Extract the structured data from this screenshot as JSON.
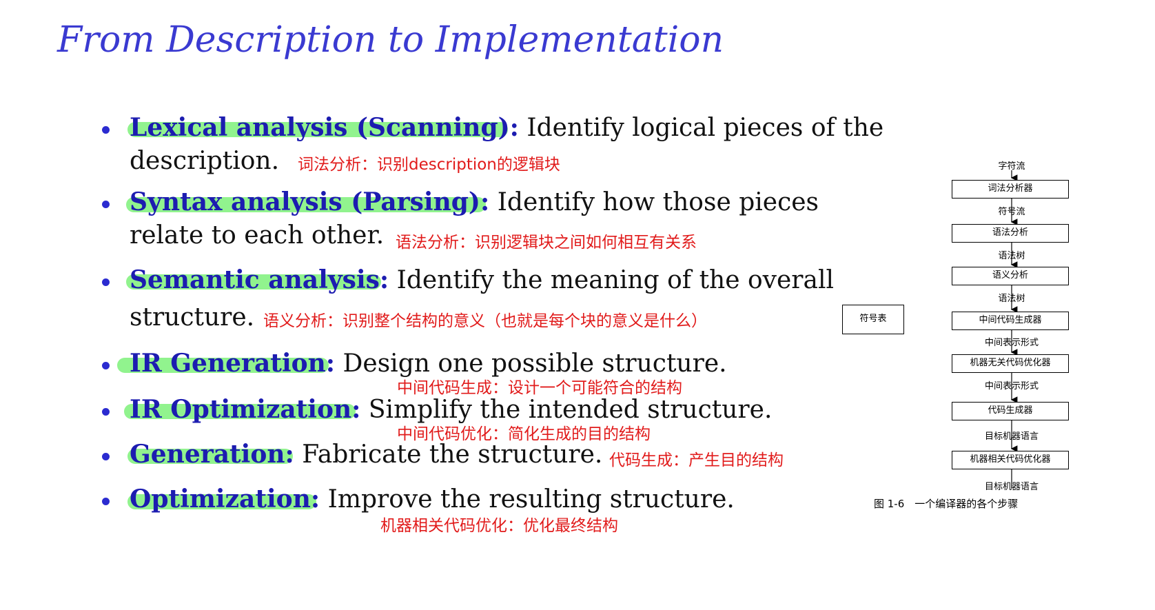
{
  "title": "From Description to Implementation",
  "items": [
    {
      "term": "Lexical analysis (Scanning):",
      "desc1": " Identify logical pieces of the",
      "desc2": "description.",
      "note": "词法分析：识别description的逻辑块"
    },
    {
      "term": "Syntax analysis (Parsing):",
      "desc1": " Identify how those pieces",
      "desc2": "relate to each other.",
      "note": "语法分析：识别逻辑块之间如何相互有关系"
    },
    {
      "term": "Semantic analysis:",
      "desc1": " Identify the meaning of the overall",
      "desc2": "structure.",
      "note": "语义分析：识别整个结构的意义（也就是每个块的意义是什么）"
    },
    {
      "term": "IR Generation:",
      "desc1": " Design one possible structure.",
      "note": "中间代码生成：设计一个可能符合的结构"
    },
    {
      "term": "IR Optimization:",
      "desc1": " Simplify the intended structure.",
      "note": "中间代码优化：简化生成的目的结构"
    },
    {
      "term": "Generation:",
      "desc1": " Fabricate the structure.",
      "note": "代码生成：产生目的结构"
    },
    {
      "term": "Optimization:",
      "desc1": " Improve the resulting structure.",
      "note": "机器相关代码优化：优化最终结构"
    }
  ],
  "diagram": {
    "symbol_table": "符号表",
    "top_label": "字符流",
    "boxes": [
      "词法分析器",
      "语法分析",
      "语义分析",
      "中间代码生成器",
      "机器无关代码优化器",
      "代码生成器",
      "机器相关代码优化器"
    ],
    "labels": [
      "符号流",
      "语法树",
      "语法树",
      "中间表示形式",
      "中间表示形式",
      "目标机器语言",
      "目标机器语言"
    ],
    "caption": "图 1-6　一个编译器的各个步骤"
  }
}
